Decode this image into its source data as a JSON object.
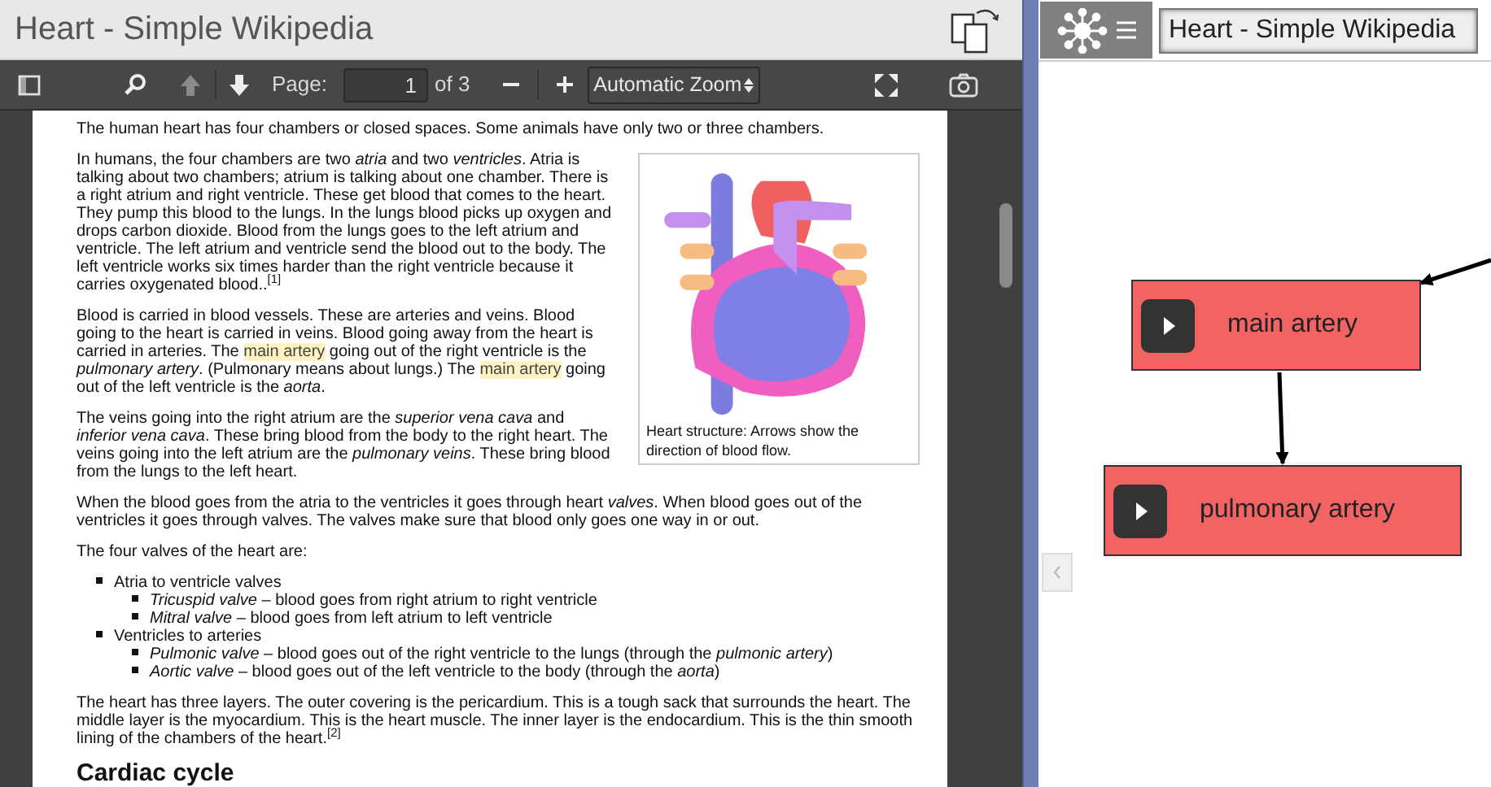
{
  "window_title": "Heart - Simple Wikipedia",
  "pdf_toolbar": {
    "page_label": "Page:",
    "page_value": "1",
    "page_count": "of 3",
    "zoom": "Automatic Zoom",
    "previous_disabled": true
  },
  "document": {
    "figure": {
      "caption": "Heart structure: Arrows show the direction of blood flow."
    },
    "blocks": [
      {
        "kind": "paragraph",
        "segments": [
          {
            "text": "The human heart has four chambers or closed spaces. Some animals have only two or three chambers.",
            "highlighted": false
          }
        ]
      },
      {
        "kind": "figure_row",
        "paragraphs": [
          {
            "segments": [
              {
                "text": "In humans, the four chambers are two *atria* and two *ventricles*. Atria is talking about two chambers; atrium is talking about one chamber. There is a right atrium and right ventricle. These get blood that comes to the heart. They pump this blood to the lungs. In the lungs blood picks up oxygen and drops carbon dioxide. Blood from the lungs goes to the left atrium and ventricle. The left atrium and ventricle send the blood out to the body. The left ventricle works six times harder than the right ventricle because it carries oxygenated blood..$^{[1]}$",
                "highlighted": false
              }
            ]
          },
          {
            "segments": [
              {
                "text": "Blood is carried in blood vessels. These are arteries and veins. Blood going to the heart is carried in veins. Blood going away from the heart is carried in arteries. The ",
                "highlighted": false
              },
              {
                "text": "main artery",
                "highlighted": true
              },
              {
                "text": " going out of the right ventricle is the *pulmonary artery*. (Pulmonary means about lungs.) The ",
                "highlighted": false
              },
              {
                "text": "main artery",
                "highlighted": true
              },
              {
                "text": " going out of the left ventricle is the *aorta*.",
                "highlighted": false
              }
            ]
          },
          {
            "segments": [
              {
                "text": "The veins going into the right atrium are the *superior vena cava* and *inferior vena cava*. These bring blood from the body to the right heart. The veins going into the left atrium are the *pulmonary veins*. These bring blood from the lungs to the left heart.",
                "highlighted": false
              }
            ]
          }
        ]
      },
      {
        "kind": "paragraph",
        "segments": [
          {
            "text": "When the blood goes from the atria to the ventricles it goes through heart *valves*. When blood goes out of the ventricles it goes through valves. The valves make sure that blood only goes one way in or out.",
            "highlighted": false
          }
        ]
      },
      {
        "kind": "paragraph",
        "segments": [
          {
            "text": "The four valves of the heart are:",
            "highlighted": false
          }
        ]
      },
      {
        "kind": "list",
        "items": [
          {
            "text": "Atria to ventricle valves",
            "children": [
              {
                "text": "*Tricuspid valve* – blood goes from right atrium to right ventricle"
              },
              {
                "text": "*Mitral valve* – blood goes from left atrium to left ventricle"
              }
            ]
          },
          {
            "text": "Ventricles to arteries",
            "children": [
              {
                "text": "*Pulmonic valve* – blood goes out of the right ventricle to the lungs (through the *pulmonic artery*)"
              },
              {
                "text": "*Aortic valve* – blood goes out of the left ventricle to the body (through the *aorta*)"
              }
            ]
          }
        ]
      },
      {
        "kind": "paragraph",
        "segments": [
          {
            "text": "The heart has three layers. The outer covering is the pericardium. This is a tough sack that surrounds the heart. The middle layer is the myocardium. This is the heart muscle. The inner layer is the endocardium. This is the thin smooth lining of the chambers of the heart.$^{[2]}$",
            "highlighted": false
          }
        ]
      },
      {
        "kind": "heading",
        "text": "Cardiac cycle"
      }
    ]
  },
  "map": {
    "title": "Heart - Simple Wikipedia",
    "nodes": [
      {
        "label": "main artery"
      },
      {
        "label": "pulmonary artery"
      }
    ]
  }
}
